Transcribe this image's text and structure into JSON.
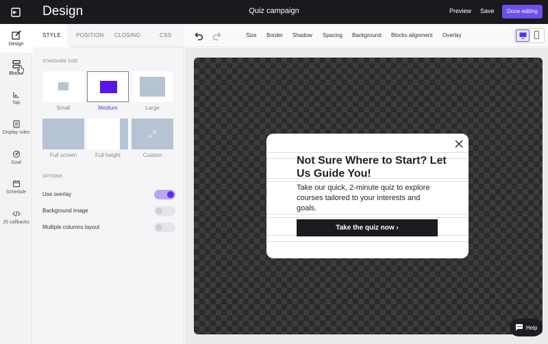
{
  "topbar": {
    "title": "Design",
    "campaign": "Quiz campaign",
    "preview_label": "Preview",
    "save_label": "Save",
    "done_label": "Done editing",
    "accent": "#6d4ff0"
  },
  "rail": {
    "items": [
      {
        "label": "Design",
        "icon": "design-icon"
      },
      {
        "label": "Blocks",
        "icon": "blocks-icon"
      },
      {
        "label": "Tab",
        "icon": "tab-icon"
      },
      {
        "label": "Display rules",
        "icon": "display-rules-icon"
      },
      {
        "label": "Goal",
        "icon": "goal-icon"
      },
      {
        "label": "Schedule",
        "icon": "schedule-icon"
      },
      {
        "label": "JS callbacks",
        "icon": "code-icon"
      }
    ]
  },
  "panel": {
    "tabs": [
      "STYLE",
      "POSITION",
      "CLOSING",
      "CSS"
    ],
    "active_tab": "STYLE",
    "standard_size_label": "STANDARD SIZE",
    "sizes": [
      "Small",
      "Medium",
      "Large",
      "Full screen",
      "Full height",
      "Custom"
    ],
    "selected_size": "Medium",
    "options_label": "OPTIONS",
    "options": [
      {
        "label": "Use overlay",
        "on": true
      },
      {
        "label": "Background image",
        "on": false
      },
      {
        "label": "Multiple columns layout",
        "on": false
      }
    ]
  },
  "toolbar": {
    "items": [
      "Size",
      "Border",
      "Shadow",
      "Spacing",
      "Background",
      "Blocks alignment",
      "Overlay"
    ],
    "undo_icon": "undo-icon",
    "redo_icon": "redo-icon",
    "active_device": "desktop"
  },
  "popup": {
    "headline": "Not Sure Where to Start? Let Us Guide You!",
    "body": "Take our quick, 2-minute quiz to explore courses tailored to your interests and goals.",
    "cta": "Take the quiz now ›"
  },
  "help": {
    "label": "Help"
  }
}
